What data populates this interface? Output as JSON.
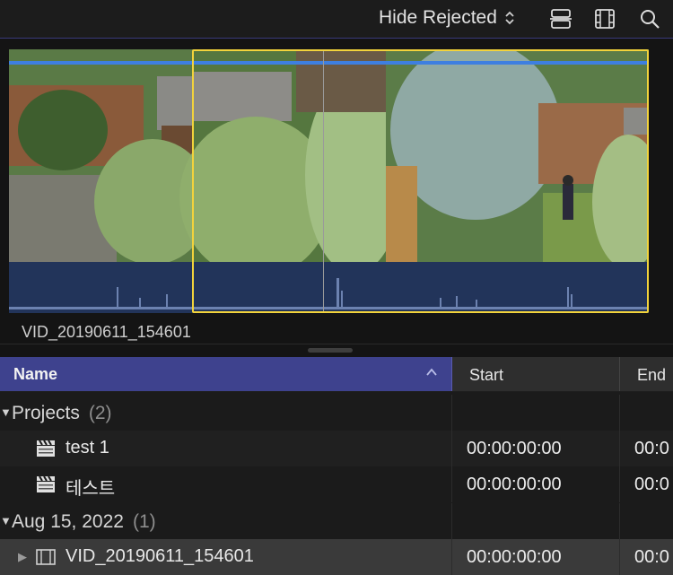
{
  "toolbar": {
    "filter_label": "Hide Rejected",
    "icons": [
      "chevron-updown-icon",
      "clip-appearance-icon",
      "filmstrip-icon",
      "search-icon"
    ]
  },
  "browser": {
    "clip_name": "VID_20190611_154601",
    "colors": {
      "selection": "#f2d33c",
      "progress": "#3e7fe0",
      "audio": "#22345a"
    }
  },
  "columns": {
    "name": "Name",
    "start": "Start",
    "end": "End"
  },
  "groups": [
    {
      "label": "Projects",
      "count": "(2)",
      "items": [
        {
          "name": "test 1",
          "start": "00:00:00:00",
          "end": "00:0"
        },
        {
          "name": "테스트",
          "start": "00:00:00:00",
          "end": "00:0"
        }
      ]
    },
    {
      "label": "Aug 15, 2022",
      "count": "(1)",
      "items": [
        {
          "name": "VID_20190611_154601",
          "start": "00:00:00:00",
          "end": "00:0"
        }
      ]
    }
  ]
}
